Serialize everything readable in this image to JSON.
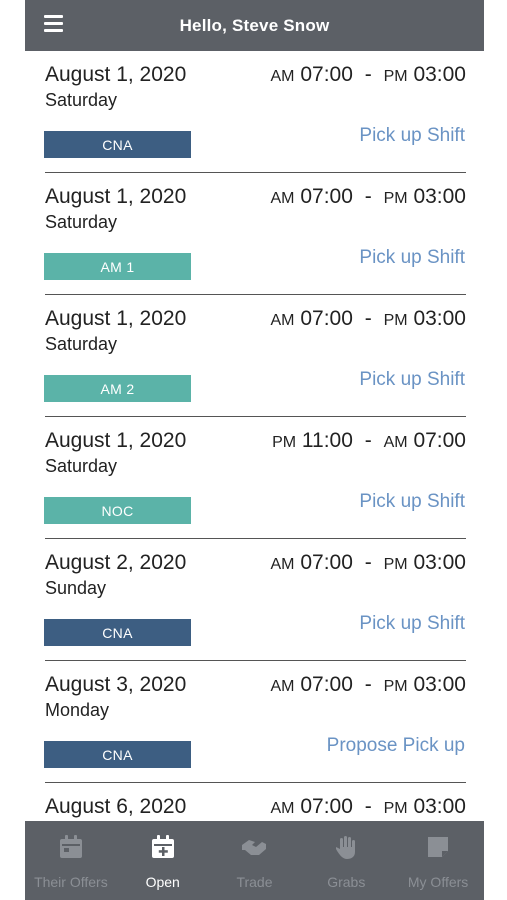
{
  "header": {
    "title": "Hello, Steve Snow",
    "menu_icon": "hamburger-menu-icon"
  },
  "shifts": [
    {
      "date": "August 1, 2020",
      "day": "Saturday",
      "start_ampm": "AM",
      "start_time": "07:00",
      "end_ampm": "PM",
      "end_time": "03:00",
      "tag": "CNA",
      "tag_color": "#3d5e82",
      "action": "Pick up Shift"
    },
    {
      "date": "August 1, 2020",
      "day": "Saturday",
      "start_ampm": "AM",
      "start_time": "07:00",
      "end_ampm": "PM",
      "end_time": "03:00",
      "tag": "AM 1",
      "tag_color": "#5bb3a8",
      "action": "Pick up Shift"
    },
    {
      "date": "August 1, 2020",
      "day": "Saturday",
      "start_ampm": "AM",
      "start_time": "07:00",
      "end_ampm": "PM",
      "end_time": "03:00",
      "tag": "AM 2",
      "tag_color": "#5bb3a8",
      "action": "Pick up Shift"
    },
    {
      "date": "August 1, 2020",
      "day": "Saturday",
      "start_ampm": "PM",
      "start_time": "11:00",
      "end_ampm": "AM",
      "end_time": "07:00",
      "tag": "NOC",
      "tag_color": "#5bb3a8",
      "action": "Pick up Shift"
    },
    {
      "date": "August 2, 2020",
      "day": "Sunday",
      "start_ampm": "AM",
      "start_time": "07:00",
      "end_ampm": "PM",
      "end_time": "03:00",
      "tag": "CNA",
      "tag_color": "#3d5e82",
      "action": "Pick up Shift"
    },
    {
      "date": "August 3, 2020",
      "day": "Monday",
      "start_ampm": "AM",
      "start_time": "07:00",
      "end_ampm": "PM",
      "end_time": "03:00",
      "tag": "CNA",
      "tag_color": "#3d5e82",
      "action": "Propose Pick up"
    },
    {
      "date": "August 6, 2020",
      "day": "",
      "start_ampm": "AM",
      "start_time": "07:00",
      "end_ampm": "PM",
      "end_time": "03:00",
      "tag": "",
      "tag_color": "#3d5e82",
      "action": ""
    }
  ],
  "tabs": [
    {
      "label": "Their Offers",
      "icon": "calendar-icon",
      "active": false
    },
    {
      "label": "Open",
      "icon": "calendar-add-icon",
      "active": true
    },
    {
      "label": "Trade",
      "icon": "handshake-icon",
      "active": false
    },
    {
      "label": "Grabs",
      "icon": "hand-icon",
      "active": false
    },
    {
      "label": "My Offers",
      "icon": "note-icon",
      "active": false
    }
  ]
}
